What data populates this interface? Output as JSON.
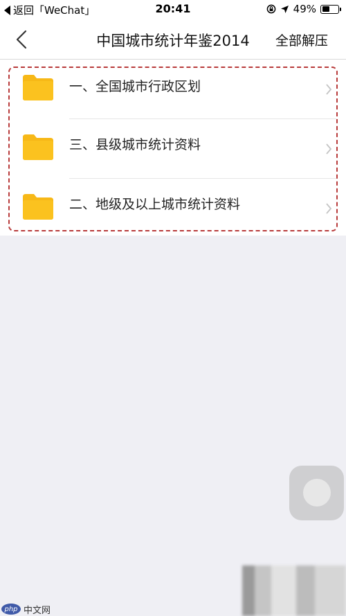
{
  "status_bar": {
    "back_label": "返回「WeChat」",
    "time": "20:41",
    "battery_text": "49%",
    "battery_level": 0.49
  },
  "nav": {
    "title": "中国城市统计年鉴2014",
    "action_label": "全部解压"
  },
  "folders": [
    {
      "label": "一、全国城市行政区划",
      "icon": "folder-icon"
    },
    {
      "label": "三、县级城市统计资料",
      "icon": "folder-icon"
    },
    {
      "label": "二、地级及以上城市统计资料",
      "icon": "folder-icon"
    }
  ],
  "colors": {
    "folder": "#f7b817",
    "highlight_border": "#b83a3a"
  },
  "watermark": {
    "logo_text": "php",
    "text": "中文网"
  }
}
